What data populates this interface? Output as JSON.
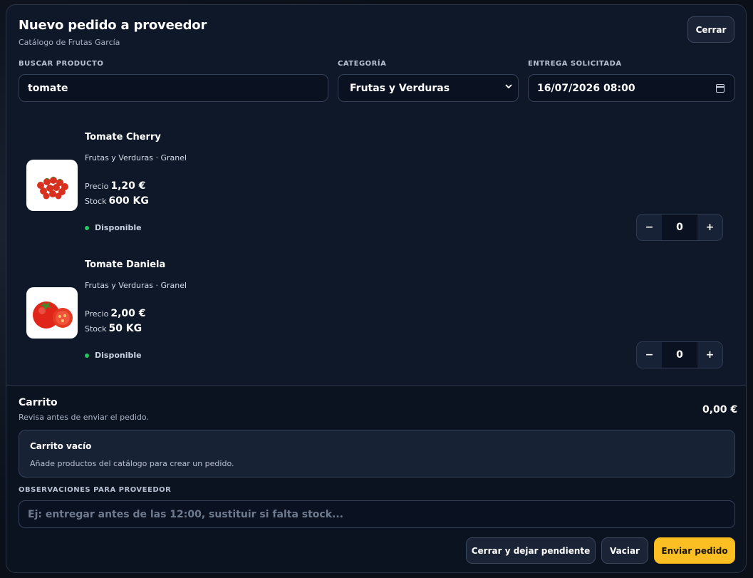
{
  "modal": {
    "title": "Nuevo pedido a proveedor",
    "subtitle": "Catálogo de Frutas García",
    "close_label": "Cerrar"
  },
  "filters": {
    "search": {
      "label": "BUSCAR PRODUCTO",
      "value": "tomate"
    },
    "category": {
      "label": "CATEGORÍA",
      "value": "Frutas y Verduras"
    },
    "delivery": {
      "label": "ENTREGA SOLICITADA",
      "value": "16/07/2026 08:00"
    }
  },
  "products": [
    {
      "name": "Tomate Cherry",
      "category": "Frutas y Verduras · Granel",
      "price_label": "Precio",
      "price": "1,20 €",
      "stock_label": "Stock",
      "stock": "600 KG",
      "availability": "Disponible",
      "quantity": "0",
      "image_icon": "cherry-tomatoes-image"
    },
    {
      "name": "Tomate Daniela",
      "category": "Frutas y Verduras · Granel",
      "price_label": "Precio",
      "price": "2,00 €",
      "stock_label": "Stock",
      "stock": "50 KG",
      "availability": "Disponible",
      "quantity": "0",
      "image_icon": "tomato-image"
    }
  ],
  "stepper": {
    "minus": "−",
    "plus": "+"
  },
  "cart": {
    "title": "Carrito",
    "subtitle": "Revisa antes de enviar el pedido.",
    "total": "0,00 €",
    "empty_title": "Carrito vacío",
    "empty_text": "Añade productos del catálogo para crear un pedido."
  },
  "notes": {
    "label": "OBSERVACIONES PARA PROVEEDOR",
    "placeholder": "Ej: entregar antes de las 12:00, sustituir si falta stock..."
  },
  "actions": {
    "close_pending": "Cerrar y dejar pendiente",
    "empty": "Vaciar",
    "send": "Enviar pedido"
  },
  "colors": {
    "accent": "#fbbf24",
    "available": "#22c55e",
    "modal_bg": "#0f1829"
  }
}
